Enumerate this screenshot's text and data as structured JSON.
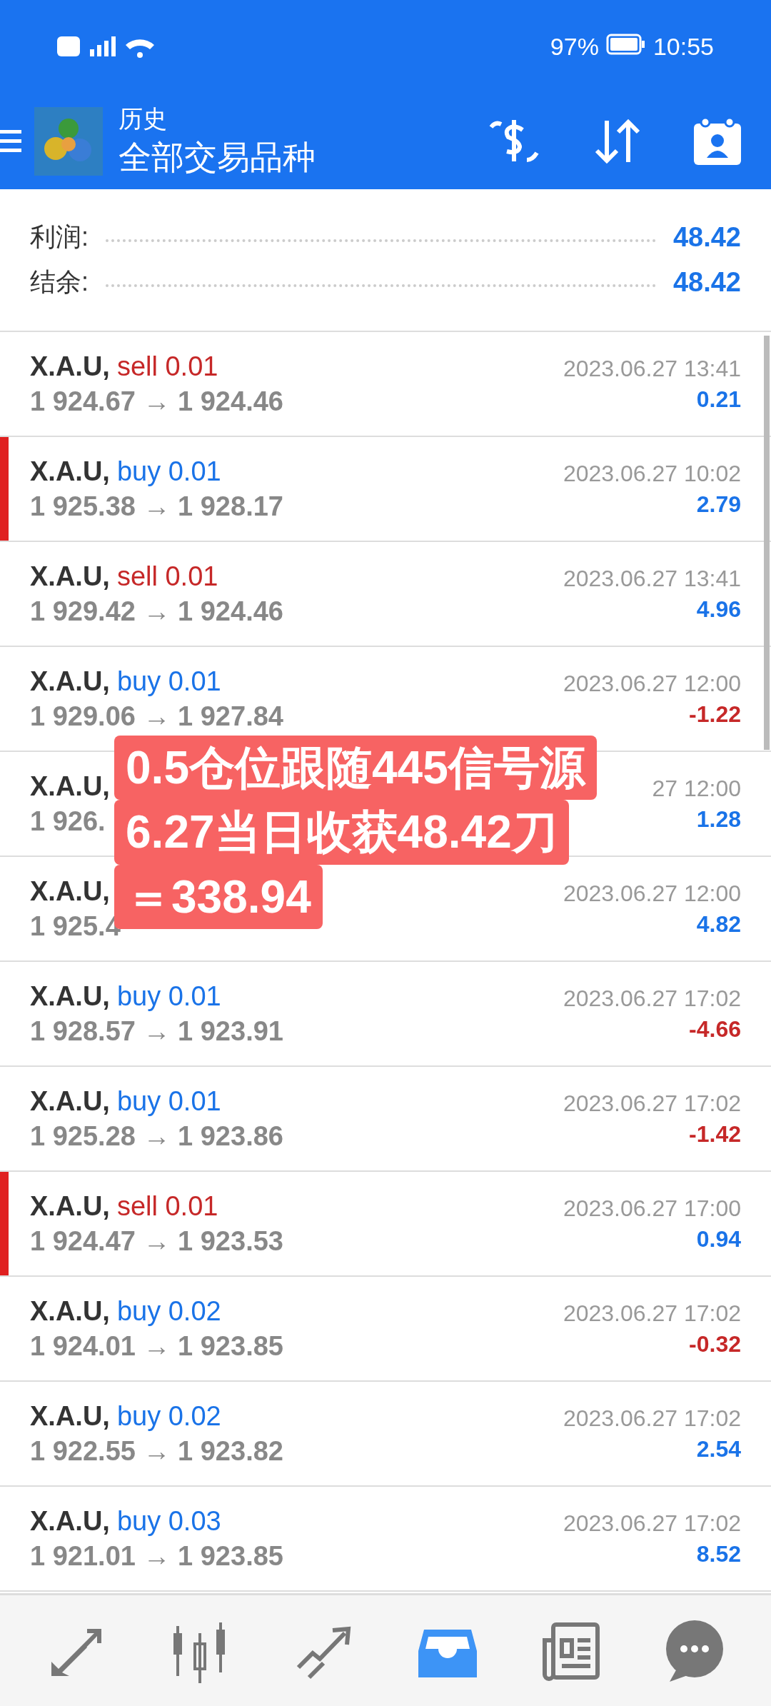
{
  "status_bar": {
    "battery": "97%",
    "time": "10:55"
  },
  "app_bar": {
    "title": "历史",
    "subtitle": "全部交易品种"
  },
  "summary": [
    {
      "label": "利润:",
      "value": "48.42"
    },
    {
      "label": "结余:",
      "value": "48.42"
    }
  ],
  "trades": [
    {
      "symbol": "X.A.U,",
      "side": "sell 0.01",
      "kind": "sell",
      "prices": "1 924.67 → 1 924.46",
      "time": "2023.06.27 13:41",
      "profit": "0.21",
      "loss": false,
      "marked": false
    },
    {
      "symbol": "X.A.U,",
      "side": "buy 0.01",
      "kind": "buy",
      "prices": "1 925.38 → 1 928.17",
      "time": "2023.06.27 10:02",
      "profit": "2.79",
      "loss": false,
      "marked": true
    },
    {
      "symbol": "X.A.U,",
      "side": "sell 0.01",
      "kind": "sell",
      "prices": "1 929.42 → 1 924.46",
      "time": "2023.06.27 13:41",
      "profit": "4.96",
      "loss": false,
      "marked": false
    },
    {
      "symbol": "X.A.U,",
      "side": "buy 0.01",
      "kind": "buy",
      "prices": "1 929.06 → 1 927.84",
      "time": "2023.06.27 12:00",
      "profit": "-1.22",
      "loss": true,
      "marked": false
    },
    {
      "symbol": "X.A.U,",
      "prices": "1 926.",
      "time": "27 12:00",
      "profit": "1.28",
      "loss": false,
      "marked": false
    },
    {
      "symbol": "X.A.U,",
      "prices": "1 925.4",
      "time": "2023.06.27 12:00",
      "profit": "4.82",
      "loss": false,
      "marked": false
    },
    {
      "symbol": "X.A.U,",
      "side": "buy 0.01",
      "kind": "buy",
      "prices": "1 928.57 → 1 923.91",
      "time": "2023.06.27 17:02",
      "profit": "-4.66",
      "loss": true,
      "marked": false
    },
    {
      "symbol": "X.A.U,",
      "side": "buy 0.01",
      "kind": "buy",
      "prices": "1 925.28 → 1 923.86",
      "time": "2023.06.27 17:02",
      "profit": "-1.42",
      "loss": true,
      "marked": false
    },
    {
      "symbol": "X.A.U,",
      "side": "sell 0.01",
      "kind": "sell",
      "prices": "1 924.47 → 1 923.53",
      "time": "2023.06.27 17:00",
      "profit": "0.94",
      "loss": false,
      "marked": true
    },
    {
      "symbol": "X.A.U,",
      "side": "buy 0.02",
      "kind": "buy",
      "prices": "1 924.01 → 1 923.85",
      "time": "2023.06.27 17:02",
      "profit": "-0.32",
      "loss": true,
      "marked": false
    },
    {
      "symbol": "X.A.U,",
      "side": "buy 0.02",
      "kind": "buy",
      "prices": "1 922.55 → 1 923.82",
      "time": "2023.06.27 17:02",
      "profit": "2.54",
      "loss": false,
      "marked": false
    },
    {
      "symbol": "X.A.U,",
      "side": "buy 0.03",
      "kind": "buy",
      "prices": "1 921.01 → 1 923.85",
      "time": "2023.06.27 17:02",
      "profit": "8.52",
      "loss": false,
      "marked": false
    }
  ],
  "sticker": [
    "0.5仓位跟随445信号源",
    "6.27当日收获48.42刀",
    "＝338.94"
  ],
  "bottom_nav": [
    {
      "kind": "trade",
      "selected": false
    },
    {
      "kind": "chart",
      "selected": false
    },
    {
      "kind": "quotes",
      "selected": false
    },
    {
      "kind": "history",
      "selected": true
    },
    {
      "kind": "news",
      "selected": false
    },
    {
      "kind": "chat",
      "selected": false
    }
  ]
}
